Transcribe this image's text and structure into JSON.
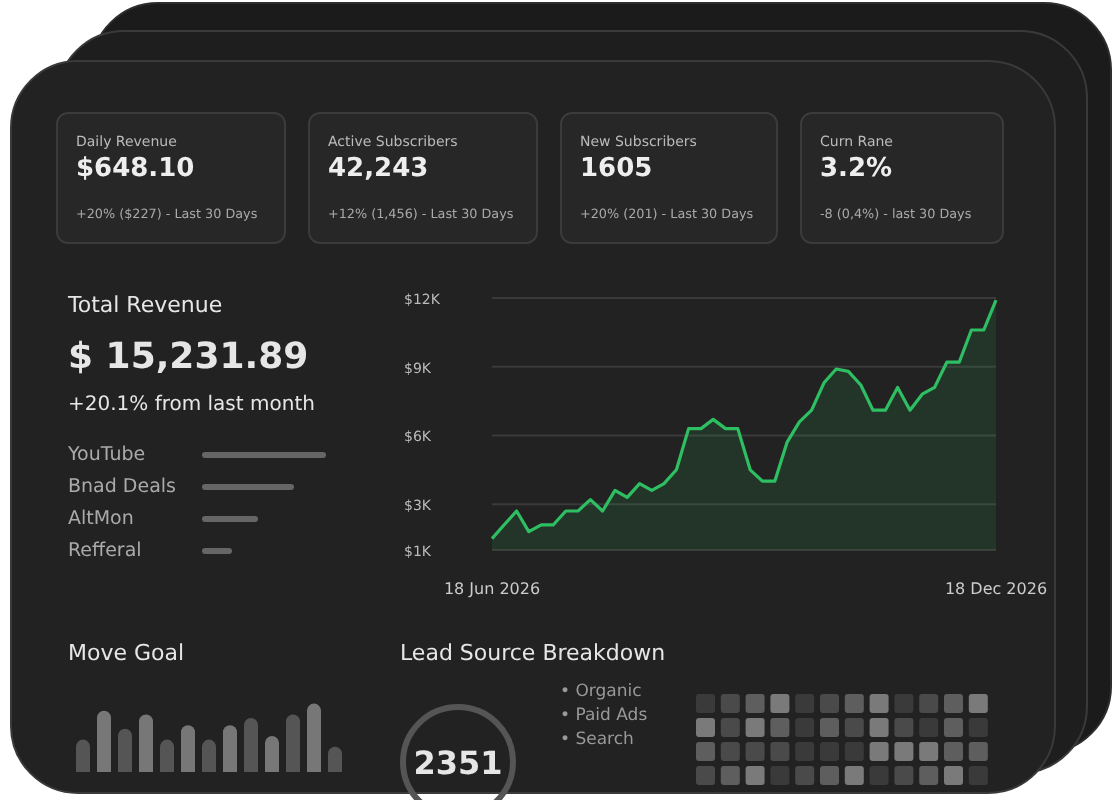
{
  "stats": [
    {
      "label": "Daily Revenue",
      "value": "$648.10",
      "change": "+20% ($227) - Last 30 Days"
    },
    {
      "label": "Active Subscribers",
      "value": "42,243",
      "change": "+12% (1,456) - Last 30 Days"
    },
    {
      "label": "New Subscribers",
      "value": "1605",
      "change": "+20% (201) - Last 30 Days"
    },
    {
      "label": "Curn Rane",
      "value": "3.2%",
      "change": "-8 (0,4%) - last 30 Days"
    }
  ],
  "revenue": {
    "title": "Total Revenue",
    "amount": "$ 15,231.89",
    "change": "+20.1% from last month",
    "sources": [
      {
        "name": "YouTube"
      },
      {
        "name": "Bnad Deals"
      },
      {
        "name": "AltMon"
      },
      {
        "name": "Refferal"
      }
    ]
  },
  "chart_data": {
    "type": "area",
    "grid": true,
    "categories": [
      "18 Jun 2026",
      null,
      null,
      null,
      null,
      null,
      null,
      null,
      null,
      null,
      null,
      null,
      null,
      null,
      null,
      null,
      null,
      null,
      null,
      null,
      null,
      null,
      null,
      null,
      null,
      null,
      null,
      null,
      null,
      null,
      null,
      null,
      null,
      null,
      null,
      null,
      null,
      null,
      null,
      null,
      null,
      "18 Dec 2026"
    ],
    "ylim": [
      1000,
      12000
    ],
    "series": [
      {
        "color": "#2fbf63",
        "values": [
          1500,
          2100,
          2700,
          1800,
          2100,
          2100,
          2700,
          2700,
          3200,
          2700,
          3600,
          3300,
          3900,
          3600,
          3900,
          4500,
          6300,
          6300,
          6700,
          6300,
          6300,
          4500,
          4000,
          4000,
          5700,
          6600,
          7100,
          8300,
          8900,
          8800,
          8200,
          7100,
          7100,
          8100,
          7100,
          7800,
          8100,
          9200,
          9200,
          10600,
          10600,
          11900
        ]
      }
    ],
    "yticks": [
      {
        "value": 1000,
        "label": "$1K"
      },
      {
        "value": 3000,
        "label": "$3K"
      },
      {
        "value": 6000,
        "label": "$6K"
      },
      {
        "value": 9000,
        "label": "$9K"
      },
      {
        "value": 12000,
        "label": "$12K"
      }
    ]
  },
  "move_goal": {
    "title": "Move Goal"
  },
  "lead_source": {
    "title": "Lead Source Breakdown",
    "total": "2351",
    "legend": [
      "• Organic",
      "• Paid Ads",
      "• Search"
    ]
  }
}
